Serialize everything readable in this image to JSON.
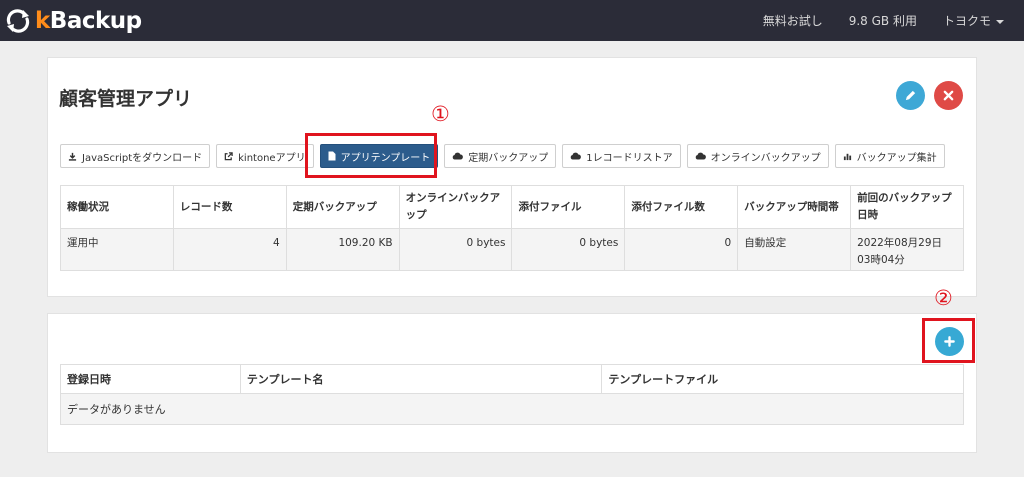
{
  "navbar": {
    "brand_k": "k",
    "brand_rest": "Backup",
    "free_trial": "無料お試し",
    "usage": "9.8 GB 利用",
    "user": "トヨクモ"
  },
  "app": {
    "title": "顧客管理アプリ"
  },
  "toolbar": {
    "download_js": "JavaScriptをダウンロード",
    "kintone_app": "kintoneアプリ",
    "app_template": "アプリテンプレート",
    "scheduled_backup": "定期バックアップ",
    "one_record_restore": "1レコードリストア",
    "online_backup": "オンラインバックアップ",
    "backup_summary": "バックアップ集計"
  },
  "status_table": {
    "headers": [
      "稼働状況",
      "レコード数",
      "定期バックアップ",
      "オンラインバックアップ",
      "添付ファイル",
      "添付ファイル数",
      "バックアップ時間帯",
      "前回のバックアップ日時"
    ],
    "row": [
      "運用中",
      "4",
      "109.20 KB",
      "0 bytes",
      "0 bytes",
      "0",
      "自動設定",
      "2022年08月29日 03時04分"
    ]
  },
  "template_table": {
    "headers": [
      "登録日時",
      "テンプレート名",
      "テンプレートファイル"
    ],
    "empty": "データがありません"
  },
  "annotations": {
    "mark1": "①",
    "mark2": "②",
    "color": "#e0141e"
  },
  "colors": {
    "navbar": "#2b2c38",
    "accent_orange": "#ff8c1a",
    "active_button": "#2c5c8c",
    "edit_button": "#3ea8d6",
    "delete_button": "#df4a46",
    "add_button": "#37a9d4"
  },
  "icons": {
    "brand": "sync-arrows-icon",
    "edit": "pencil-icon",
    "delete": "close-icon",
    "add": "plus-icon"
  }
}
